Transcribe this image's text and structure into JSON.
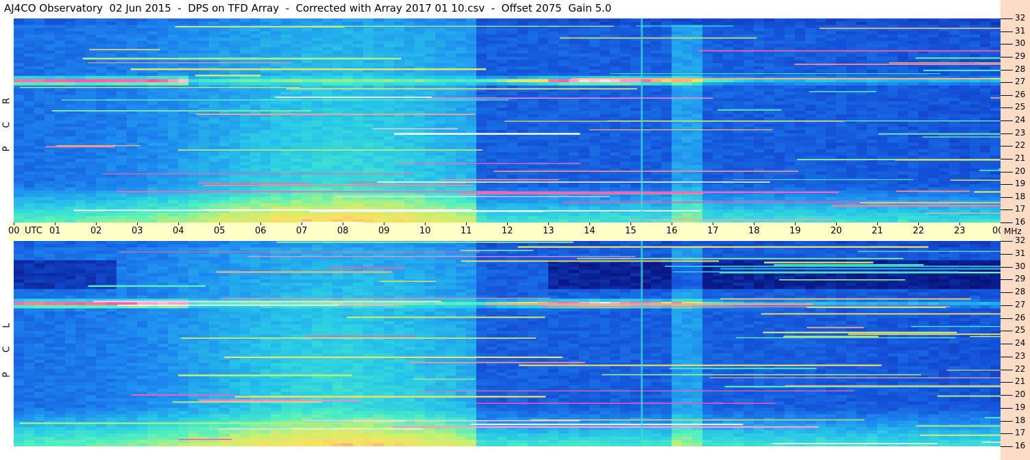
{
  "title": "AJ4CO Observatory  02 Jun 2015  -  DPS on TFD Array  -  Corrected with Array 2017 01 10.csv  -  Offset 2075  Gain 5.0",
  "chart_data": [
    {
      "type": "heatmap",
      "panel": "RCP",
      "polarization_label": [
        "R",
        "C",
        "P"
      ],
      "x_range_utc_hours": [
        0,
        24
      ],
      "y_range_mhz": [
        16,
        32
      ]
    },
    {
      "type": "heatmap",
      "panel": "LCP",
      "polarization_label": [
        "L",
        "C",
        "P"
      ],
      "x_range_utc_hours": [
        0,
        24
      ],
      "y_range_mhz": [
        16,
        32
      ]
    }
  ],
  "time_axis": {
    "labels": [
      "00",
      "01",
      "02",
      "03",
      "04",
      "05",
      "06",
      "07",
      "08",
      "09",
      "10",
      "11",
      "12",
      "13",
      "14",
      "15",
      "16",
      "17",
      "18",
      "19",
      "20",
      "21",
      "22",
      "23",
      "00"
    ],
    "unit": "UTC"
  },
  "freq_axis": {
    "labels": [
      "32",
      "31",
      "30",
      "29",
      "28",
      "27",
      "26",
      "25",
      "24",
      "23",
      "22",
      "21",
      "20",
      "19",
      "18",
      "17",
      "16"
    ],
    "unit": "MHz"
  },
  "colors": {
    "colormap": [
      "#000030",
      "#0a1a8a",
      "#1450d8",
      "#1e8af0",
      "#28c8e8",
      "#50f0c0",
      "#c8f070",
      "#ffe060",
      "#ff50b4",
      "#ffffff"
    ],
    "time_axis_bg": "#ffffc8",
    "freq_strip_bg": "#fcdcc4"
  }
}
